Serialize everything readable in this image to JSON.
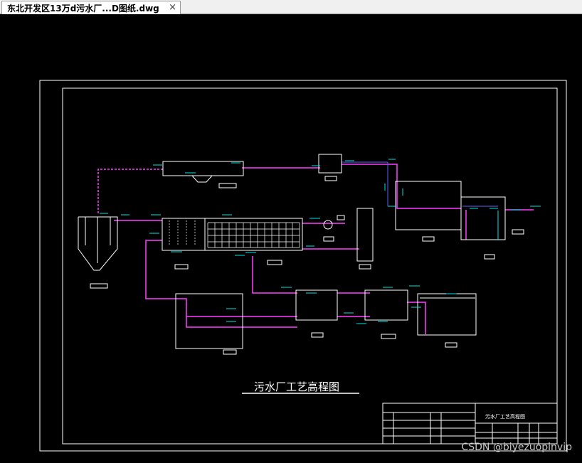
{
  "tab": {
    "title": "东北开发区13万d污水厂...D图纸.dwg",
    "close_glyph": "×"
  },
  "drawing": {
    "title": "污水厂工艺高程图",
    "title_block_label": "污水厂工艺高程图"
  },
  "watermark": "CSDN @biyezuopinvip",
  "colors": {
    "background": "#000000",
    "frame": "#ffffff",
    "pipe": "#ff40ff",
    "annotation": "#00e5e5",
    "blue": "#6060ff"
  }
}
